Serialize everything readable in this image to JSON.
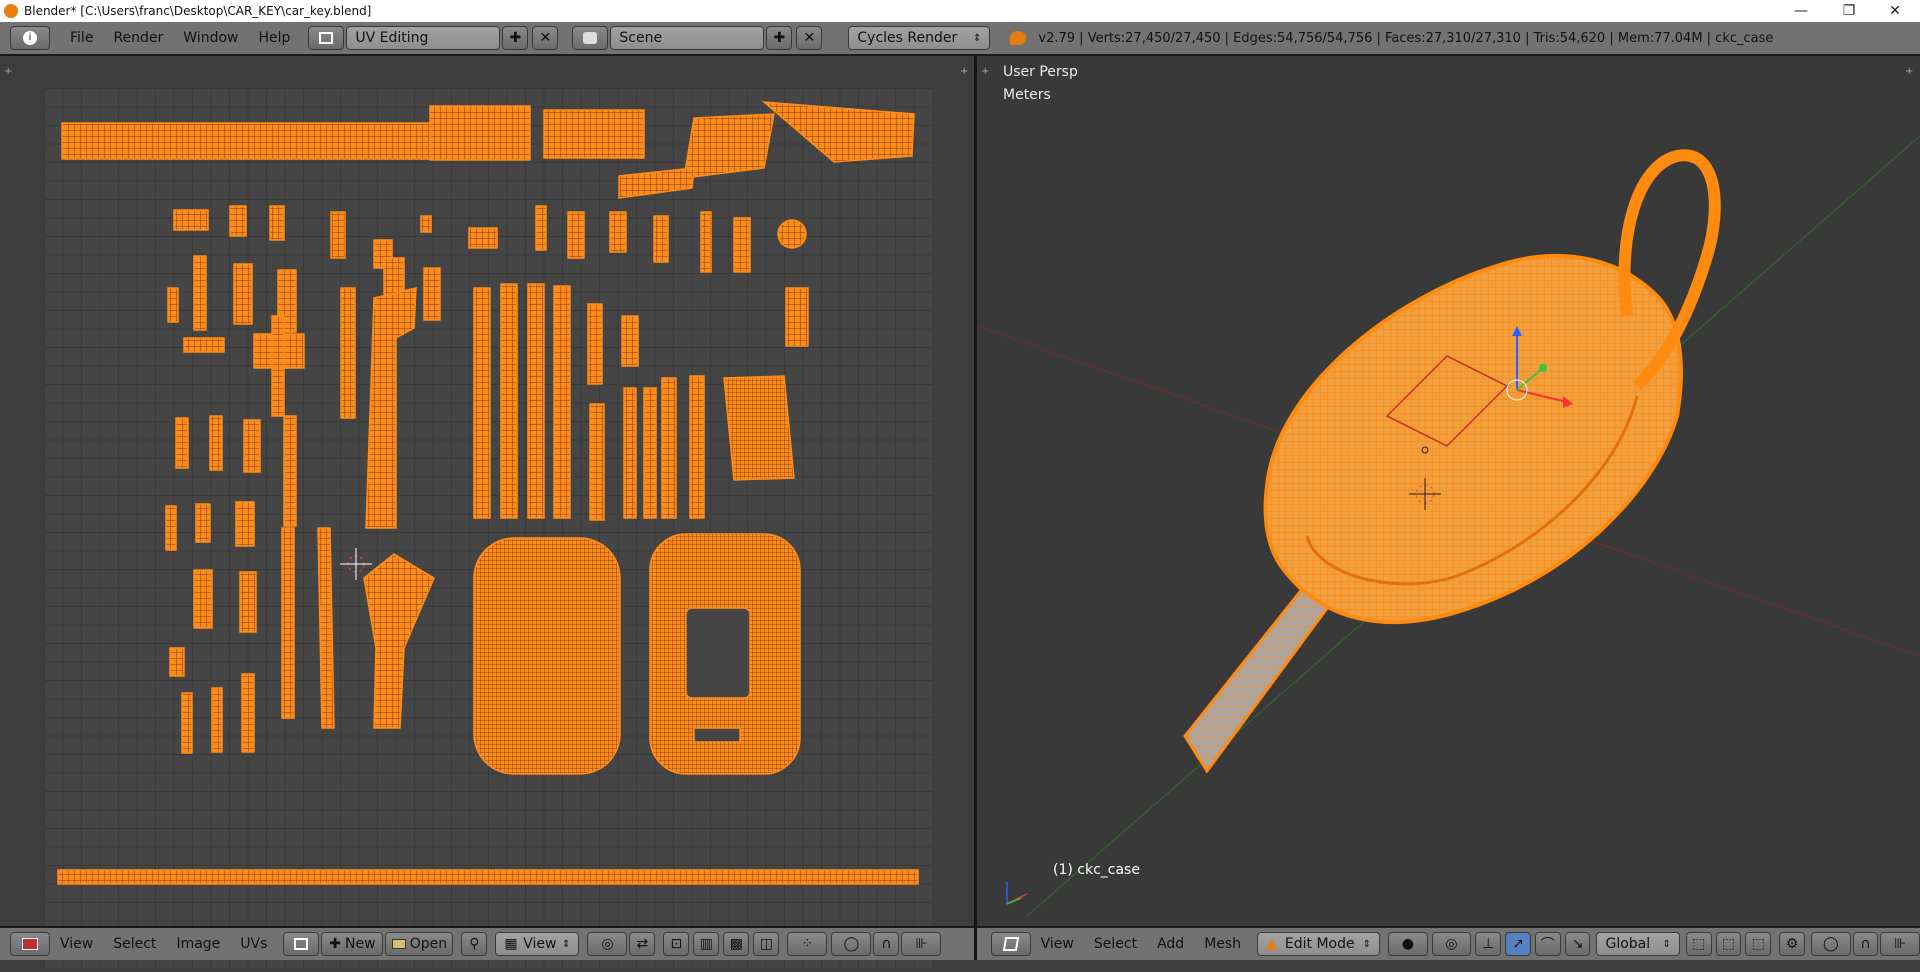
{
  "window": {
    "title": "Blender* [C:\\Users\\franc\\Desktop\\CAR_KEY\\car_key.blend]",
    "controls": {
      "minimize": "—",
      "maximize": "❐",
      "close": "✕"
    }
  },
  "info_bar": {
    "menus": [
      "File",
      "Render",
      "Window",
      "Help"
    ],
    "screen_layout": "UV Editing",
    "scene": "Scene",
    "render_engine": "Cycles Render",
    "stats": "v2.79 | Verts:27,450/27,450 | Edges:54,756/54,756 | Faces:27,310/27,310 | Tris:54,620 | Mem:77.04M | ckc_case"
  },
  "viewport": {
    "view_name": "User Persp",
    "units": "Meters",
    "object_label": "(1) ckc_case"
  },
  "uv_footer": {
    "menus": [
      "View",
      "Select",
      "Image",
      "UVs"
    ],
    "new_label": "New",
    "open_label": "Open",
    "view_select": "View"
  },
  "view3d_footer": {
    "menus": [
      "View",
      "Select",
      "Add",
      "Mesh"
    ],
    "mode": "Edit Mode",
    "orientation": "Global"
  },
  "colors": {
    "uv_orange": "#ff8c1a",
    "header_bg": "#727272",
    "editor_bg": "#3d3d3d"
  }
}
